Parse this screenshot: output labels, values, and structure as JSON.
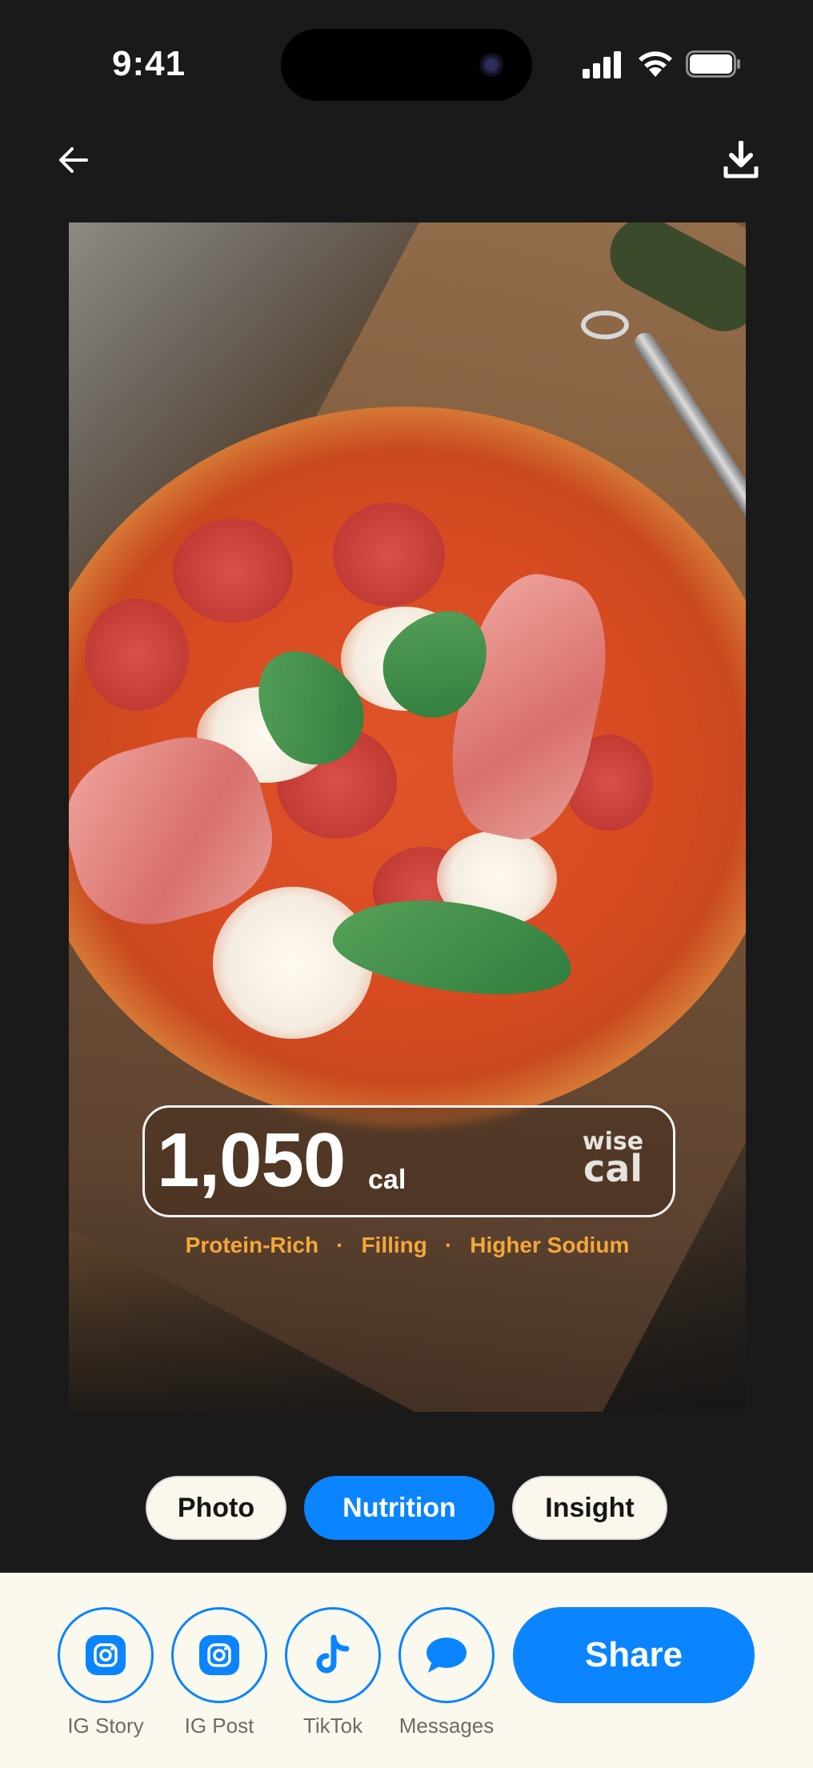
{
  "status_bar": {
    "time": "9:41"
  },
  "top_bar": {
    "back_icon": "arrow-left-icon",
    "download_icon": "download-icon"
  },
  "photo_card": {
    "subject": "pizza",
    "calories_value": "1,050",
    "calories_unit": "cal",
    "brand_logo_top": "wise",
    "brand_logo_bottom": "cal",
    "tags": [
      "Protein-Rich",
      "Filling",
      "Higher Sodium"
    ],
    "tag_color": "#f3a73a"
  },
  "mode_tabs": [
    {
      "label": "Photo",
      "active": false
    },
    {
      "label": "Nutrition",
      "active": true
    },
    {
      "label": "Insight",
      "active": false
    }
  ],
  "share": {
    "targets": [
      {
        "label": "IG Story",
        "icon": "instagram-icon"
      },
      {
        "label": "IG Post",
        "icon": "instagram-icon"
      },
      {
        "label": "TikTok",
        "icon": "tiktok-icon"
      },
      {
        "label": "Messages",
        "icon": "message-bubble-icon"
      }
    ],
    "button_label": "Share"
  },
  "colors": {
    "accent": "#0a84ff",
    "background": "#1a1a1b",
    "panel": "#fbf8ee"
  }
}
